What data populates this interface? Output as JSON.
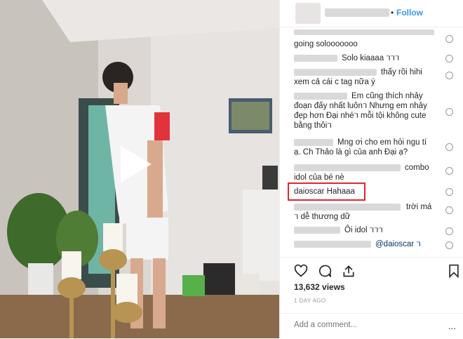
{
  "header": {
    "follow_separator": "•",
    "follow_label": "Follow"
  },
  "comments": [
    {
      "username": "",
      "text": "going solooooooo"
    },
    {
      "username": "",
      "text": "Solo kiaaaa 𐔕𐔕𐔕"
    },
    {
      "username": "",
      "text": "thấy rồi hihi"
    },
    {
      "username": "",
      "text": "xem cả cái c tag nữa ý"
    },
    {
      "username": "",
      "text": "Em cũng thích nhảy"
    },
    {
      "username": "",
      "text": "đoạn đấy nhất luôn𐔕 Nhưng em nhảy"
    },
    {
      "username": "",
      "text": "đẹp hơn Đại nhé𐔕 mỗi tội không cute"
    },
    {
      "username": "",
      "text": "bằng thôi𐔕"
    },
    {
      "username": "",
      "text": "Mng ơi cho em hỏi ngu tí"
    },
    {
      "username": "",
      "text": "ạ. Ch Thảo là gì của anh Đại ạ?"
    },
    {
      "username": "",
      "text": "combo"
    },
    {
      "username": "",
      "text": "idol của bé nè"
    },
    {
      "username": "daioscar",
      "text": "Hahaaa"
    },
    {
      "username": "",
      "text": "trời má"
    },
    {
      "username": "",
      "text": "𐔕 dễ thương dữ"
    },
    {
      "username": "",
      "text": "Ôi idol 𐔕𐔕𐔕"
    },
    {
      "username": "",
      "text": "@daioscar 𐔕"
    }
  ],
  "stats": {
    "views": "13,632 views",
    "posted": "1 DAY AGO"
  },
  "add_comment": {
    "placeholder": "Add a comment...",
    "more": "..."
  },
  "colors": {
    "follow": "#3897f0",
    "highlight": "#e0262e"
  },
  "icons": [
    "play-icon",
    "heart-icon",
    "comment-icon",
    "share-icon",
    "bookmark-icon",
    "more-icon"
  ]
}
